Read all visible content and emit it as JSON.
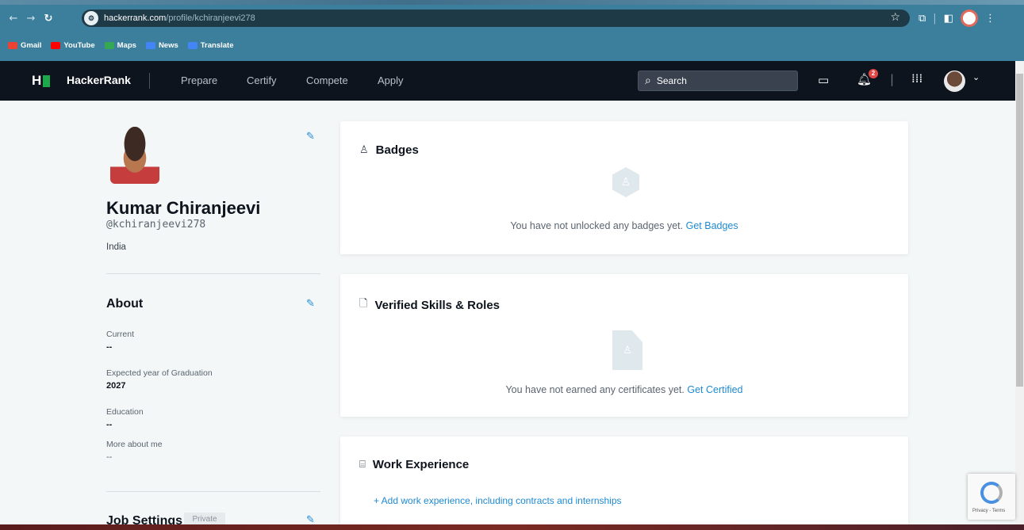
{
  "browser": {
    "url_host": "hackerrank.com",
    "url_path": "/profile/kchiranjeevi278",
    "bookmarks": [
      {
        "label": "Gmail",
        "color": "#ea4335"
      },
      {
        "label": "YouTube",
        "color": "#ff0000"
      },
      {
        "label": "Maps",
        "color": "#34a853"
      },
      {
        "label": "News",
        "color": "#4285f4"
      },
      {
        "label": "Translate",
        "color": "#4285f4"
      }
    ]
  },
  "nav": {
    "logo_letter": "H",
    "brand": "HackerRank",
    "links": [
      "Prepare",
      "Certify",
      "Compete",
      "Apply"
    ],
    "search_placeholder": "Search",
    "notification_count": "2",
    "accent_color": "#1ba94c"
  },
  "profile": {
    "name": "Kumar Chiranjeevi",
    "handle": "@kchiranjeevi278",
    "country": "India",
    "about_title": "About",
    "fields": [
      {
        "label": "Current",
        "value": "--"
      },
      {
        "label": "Expected year of Graduation",
        "value": "2027"
      },
      {
        "label": "Education",
        "value": "--"
      },
      {
        "label": "More about me",
        "value": "--"
      }
    ],
    "job_settings_title": "Job Settings",
    "job_settings_badge": "Private"
  },
  "badges": {
    "title": "Badges",
    "empty_text": "You have not unlocked any badges yet.",
    "link": "Get Badges"
  },
  "skills": {
    "title": "Verified Skills & Roles",
    "empty_text": "You have not earned any certificates yet.",
    "link": "Get Certified"
  },
  "work": {
    "title": "Work Experience",
    "add_link": "+ Add work experience, including contracts and internships"
  },
  "recaptcha": {
    "footer": "Privacy - Terms"
  }
}
